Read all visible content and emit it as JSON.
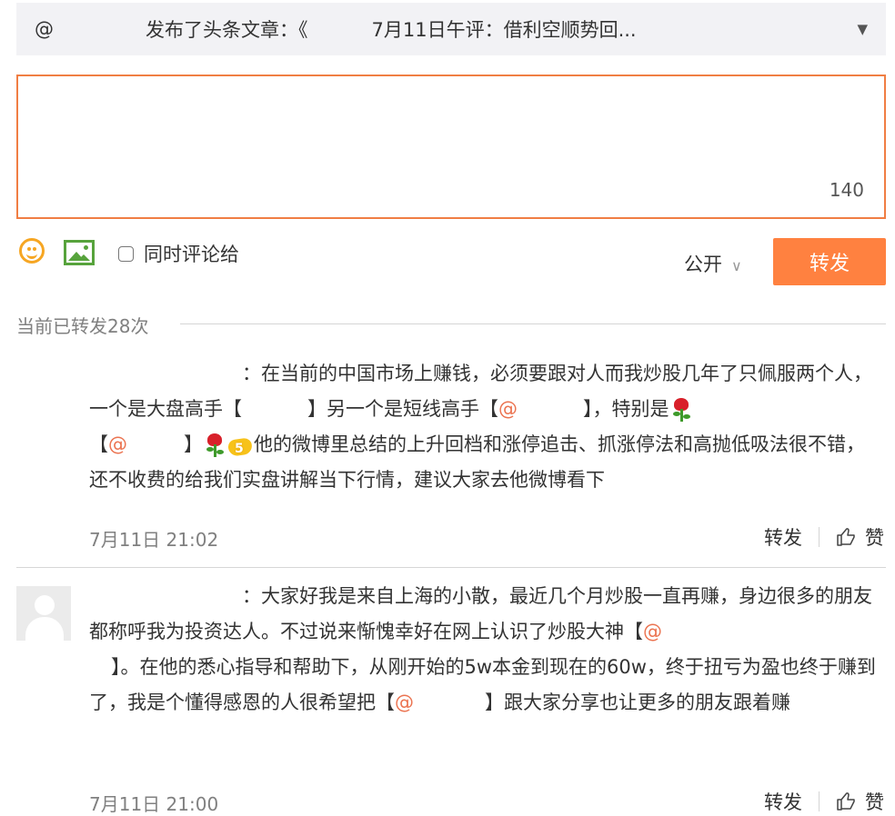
{
  "share_bar": {
    "at_symbol": "@",
    "text_before": "发布了头条文章：《",
    "text_after": "7月11日午评：借利空顺势回...",
    "dropdown_icon": "caret-down-icon"
  },
  "composer": {
    "char_count": "140"
  },
  "toolbar": {
    "emoji_icon": "smiley-icon",
    "image_icon": "image-icon",
    "also_comment_label": "同时评论给",
    "privacy_label": "公开",
    "forward_button": "转发"
  },
  "repost_count_label": "当前已转发28次",
  "posts": [
    {
      "seg1": "：在当前的中国市场上赚钱，必须要跟对人而我炒股几年了只佩服两个人，一个是大盘高手【",
      "seg2": "】另一个是短线高手【",
      "mention1": "@",
      "seg3": "】，特别是",
      "seg4": "【",
      "mention2": "@",
      "seg5": "】",
      "seg6": "他的微博里总结的上升回档和涨停追击、抓涨停法和高抛低吸法很不错，还不收费的给我们实盘讲解当下行情，建议大家去他微博看下",
      "time": "7月11日 21:02",
      "forward": "转发",
      "like": "赞"
    },
    {
      "seg1": "：大家好我是来自上海的小散，最近几个月炒股一直再赚，身边很多的朋友都称呼我为投资达人。不过说来惭愧幸好在网上认识了炒股大神【",
      "mention1": "@",
      "seg2": "】。在他的悉心指导和帮助下，从刚开始的5w本金到现在的60w，终于扭亏为盈也终于赚到了，我是个懂得感恩的人很希望把【",
      "mention2": "@",
      "seg3": "】跟大家分享也让更多的朋友跟着赚",
      "time": "7月11日 21:00",
      "forward": "转发",
      "like": "赞"
    }
  ]
}
